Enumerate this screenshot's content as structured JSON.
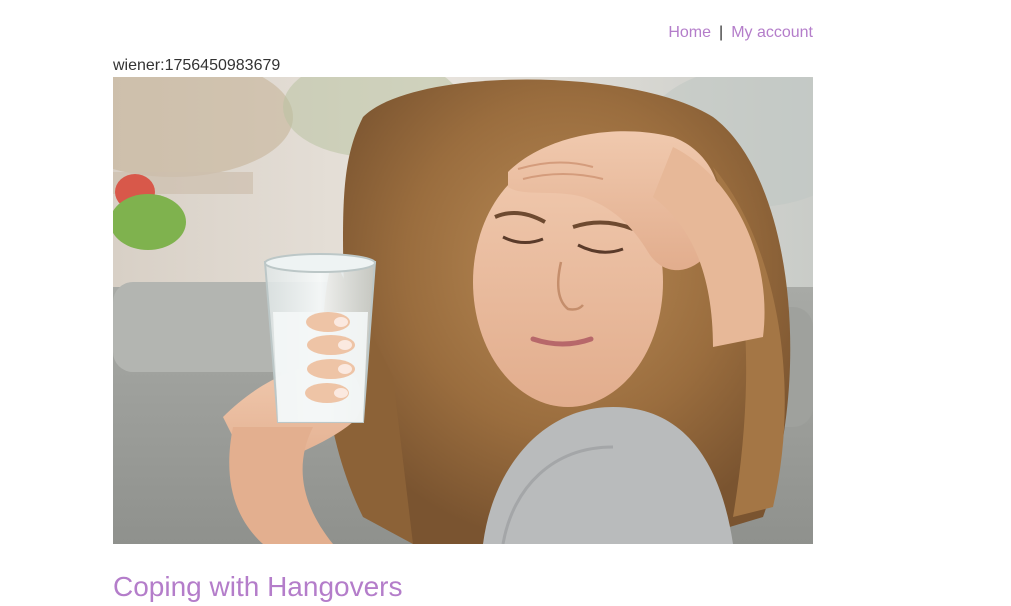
{
  "nav": {
    "home_label": "Home",
    "separator": "|",
    "account_label": "My account"
  },
  "session": {
    "text": "wiener:1756450983679"
  },
  "post": {
    "image_alt": "Woman holding a glass of water with a hand on her forehead",
    "title": "Coping with Hangovers"
  },
  "colors": {
    "link": "#b47dca",
    "text": "#333333",
    "background": "#ffffff"
  }
}
